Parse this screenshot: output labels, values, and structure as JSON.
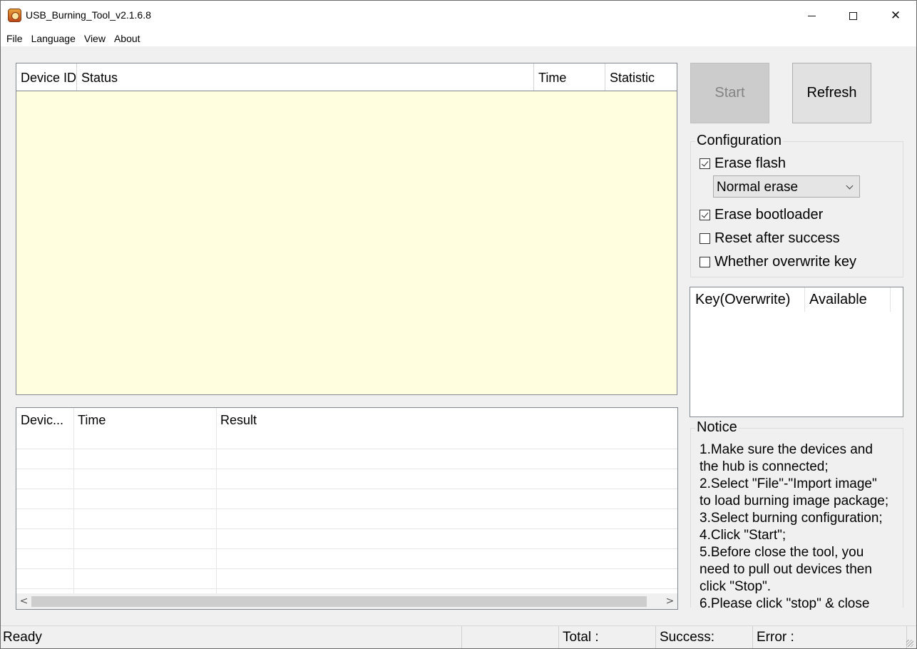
{
  "window": {
    "title": "USB_Burning_Tool_v2.1.6.8",
    "controls": {
      "minimize": "minimize-icon",
      "maximize": "maximize-icon",
      "close": "✕"
    }
  },
  "menu": [
    "File",
    "Language",
    "View",
    "About"
  ],
  "device_table": {
    "columns": [
      "Device ID",
      "Status",
      "Time",
      "Statistic"
    ]
  },
  "result_table": {
    "columns": [
      "Devic...",
      "Time",
      "Result"
    ],
    "scroll_left": "<",
    "scroll_right": ">"
  },
  "buttons": {
    "start": "Start",
    "refresh": "Refresh"
  },
  "configuration": {
    "label": "Configuration",
    "erase_flash": {
      "label": "Erase flash",
      "checked": true
    },
    "erase_mode": "Normal erase",
    "erase_bootloader": {
      "label": "Erase bootloader",
      "checked": true
    },
    "reset_after_success": {
      "label": "Reset after success",
      "checked": false
    },
    "overwrite_key": {
      "label": "Whether overwrite key",
      "checked": false
    }
  },
  "key_table": {
    "columns": [
      "Key(Overwrite)",
      "Available"
    ]
  },
  "notice": {
    "label": "Notice",
    "lines": [
      "1.Make sure the devices and",
      "the hub is connected;",
      "2.Select \"File\"-\"Import image\"",
      "to load burning image package;",
      "3.Select burning configuration;",
      "4.Click \"Start\";",
      "5.Before close the tool, you",
      "need to pull out devices then",
      "click \"Stop\".",
      "6.Please click \"stop\" & close"
    ]
  },
  "statusbar": {
    "state": "Ready",
    "total": "Total :",
    "success": "Success:",
    "error": "Error :"
  },
  "colors": {
    "device_table_bg": "#ffffe0",
    "window_bg": "#f0f0f0",
    "disabled_text": "#838383"
  }
}
